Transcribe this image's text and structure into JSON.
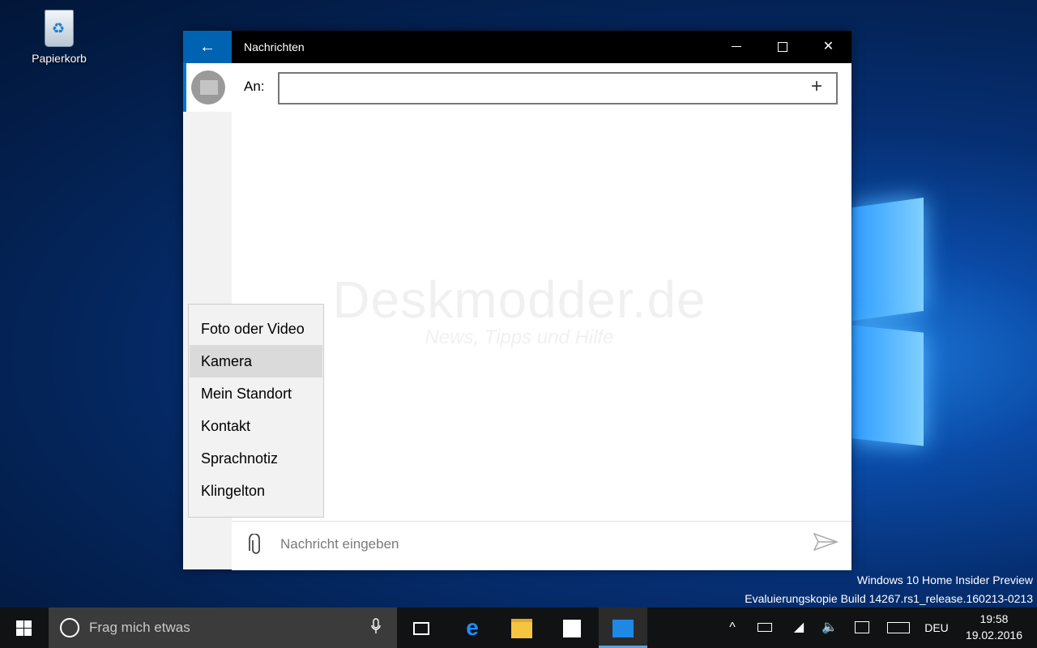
{
  "desktop": {
    "recycle_bin_label": "Papierkorb",
    "build_line1": "Windows 10 Home Insider Preview",
    "build_line2": "Evaluierungskopie Build 14267.rs1_release.160213-0213"
  },
  "window": {
    "title": "Nachrichten",
    "back_glyph": "←",
    "minimize_glyph": "—",
    "maximize_glyph": "☐",
    "close_glyph": "✕"
  },
  "compose": {
    "to_label": "An:",
    "to_value": "",
    "add_glyph": "+",
    "message_placeholder": "Nachricht eingeben",
    "attach_glyph": "📎",
    "send_glyph": "➢"
  },
  "watermark": {
    "title": "Deskmodder.de",
    "subtitle": "News, Tipps und Hilfe"
  },
  "attach_menu": {
    "items": [
      "Foto oder Video",
      "Kamera",
      "Mein Standort",
      "Kontakt",
      "Sprachnotiz",
      "Klingelton"
    ],
    "highlighted": "Kamera"
  },
  "taskbar": {
    "search_placeholder": "Frag mich etwas",
    "language": "DEU",
    "time": "19:58",
    "date": "19.02.2016",
    "icons": [
      "windows-start-icon",
      "cortana-icon",
      "microphone-icon",
      "task-view-icon",
      "edge-icon",
      "file-explorer-icon",
      "store-icon",
      "messaging-icon",
      "chevron-up-icon",
      "battery-icon",
      "wifi-icon",
      "volume-icon",
      "action-center-icon",
      "keyboard-icon"
    ]
  },
  "colors": {
    "accent": "#0063b1",
    "titlebar": "#000000",
    "taskbar": "#101214"
  }
}
